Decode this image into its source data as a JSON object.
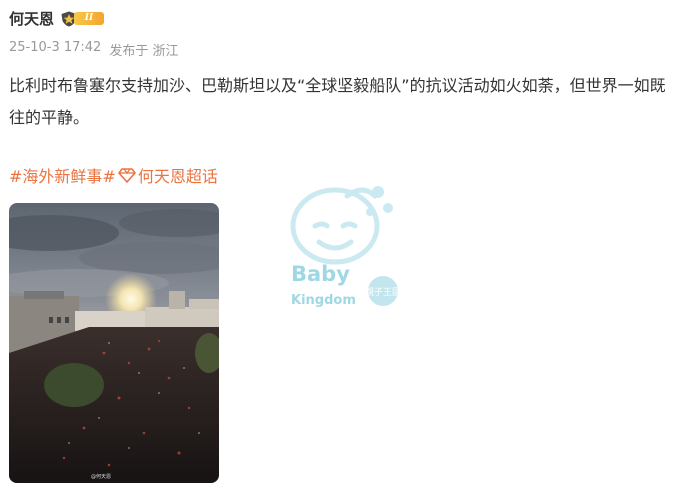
{
  "post": {
    "username": "何天恩",
    "level_badge": "II",
    "date": "25-10-3 17:42",
    "source": "发布于 浙江",
    "text": "比利时布鲁塞尔支持加沙、巴勒斯坦以及“全球坚毅船队”的抗议活动如火如荼，但世界一如既往的平静。",
    "hashtag1": "#海外新鲜事#",
    "hashtag2": "何天恩超话",
    "photo_credit": "@何天恩"
  },
  "watermark": {
    "line1": "Baby",
    "line2": "Kingdom",
    "seal": "親子王國"
  },
  "colors": {
    "hashtag": "#eb7340",
    "meta": "#999999",
    "watermark": "#9fd8e4"
  },
  "icons": [
    "vip-shield-icon",
    "diamond-icon"
  ]
}
